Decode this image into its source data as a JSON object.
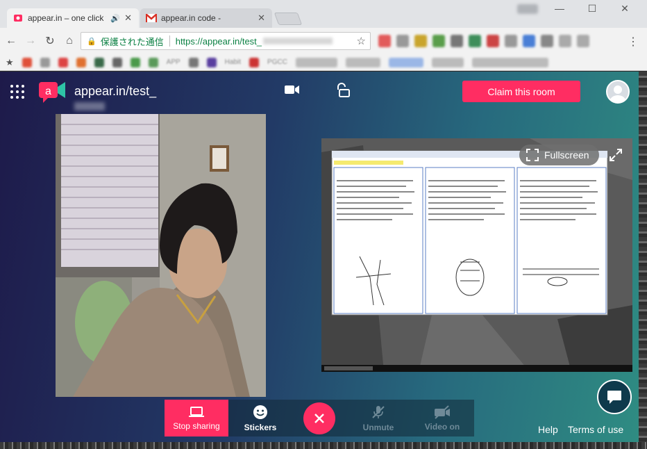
{
  "browser": {
    "tabs": [
      {
        "title": "appear.in – one click v",
        "active": true
      },
      {
        "title": "appear.in code - ",
        "active": false
      }
    ],
    "window_controls": {
      "minimize": "—",
      "maximize": "☐",
      "close": "✕"
    },
    "address_bar": {
      "security_label": "保護された通信",
      "url": "https://appear.in/test_"
    },
    "bookmarks": {
      "app_label": "APP",
      "items": [
        "Habit",
        "PGCC"
      ]
    }
  },
  "room": {
    "name": "appear.in/test_",
    "claim_button": "Claim this room",
    "fullscreen_label": "Fullscreen",
    "controls": {
      "stop_sharing": "Stop sharing",
      "stickers": "Stickers",
      "unmute": "Unmute",
      "video_on": "Video on"
    },
    "footer": {
      "help": "Help",
      "terms": "Terms of use"
    }
  },
  "colors": {
    "accent": "#ff2d62",
    "secure_green": "#0b8043"
  }
}
